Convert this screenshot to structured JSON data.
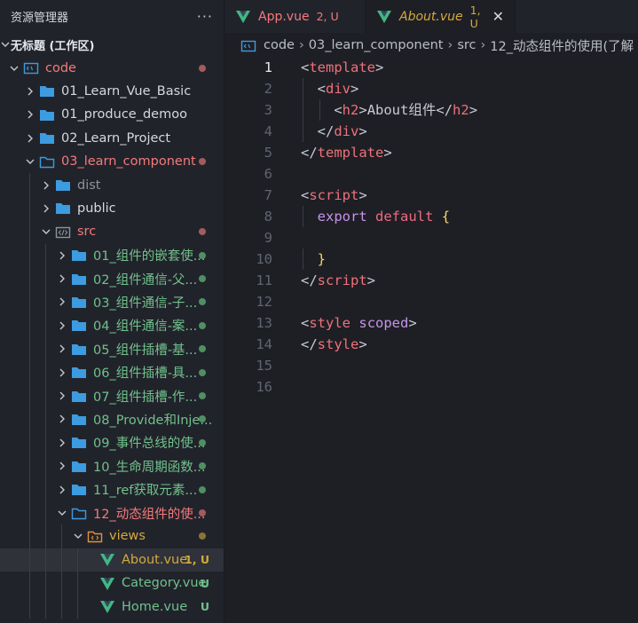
{
  "explorer": {
    "title": "资源管理器",
    "more": "···",
    "workspace": "无标题 (工作区)",
    "items": [
      {
        "label": "code",
        "type": "code-root",
        "level": 1,
        "expanded": true,
        "color": "#f47a7a",
        "status": "dot",
        "status_color": "#a35b5f"
      },
      {
        "label": "01_Learn_Vue_Basic",
        "type": "folder",
        "level": 2,
        "expanded": false,
        "color": "#d5d8de"
      },
      {
        "label": "01_produce_demoo",
        "type": "folder",
        "level": 2,
        "expanded": false,
        "color": "#d5d8de"
      },
      {
        "label": "02_Learn_Project",
        "type": "folder",
        "level": 2,
        "expanded": false,
        "color": "#d5d8de"
      },
      {
        "label": "03_learn_component",
        "type": "folder-open",
        "level": 2,
        "expanded": true,
        "color": "#f47a7a",
        "status": "dot",
        "status_color": "#a35b5f"
      },
      {
        "label": "dist",
        "type": "folder-gray",
        "level": 3,
        "expanded": false,
        "color": "#8e939b"
      },
      {
        "label": "public",
        "type": "folder",
        "level": 3,
        "expanded": false,
        "color": "#d5d8de"
      },
      {
        "label": "src",
        "type": "src",
        "level": 3,
        "expanded": true,
        "color": "#f47a7a",
        "status": "dot",
        "status_color": "#a35b5f"
      },
      {
        "label": "01_组件的嵌套使...",
        "type": "folder",
        "level": 4,
        "expanded": false,
        "color": "#71c18c",
        "status": "dot",
        "status_color": "#4f8f64"
      },
      {
        "label": "02_组件通信-父...",
        "type": "folder",
        "level": 4,
        "expanded": false,
        "color": "#71c18c",
        "status": "dot",
        "status_color": "#4f8f64"
      },
      {
        "label": "03_组件通信-子...",
        "type": "folder",
        "level": 4,
        "expanded": false,
        "color": "#71c18c",
        "status": "dot",
        "status_color": "#4f8f64"
      },
      {
        "label": "04_组件通信-案...",
        "type": "folder",
        "level": 4,
        "expanded": false,
        "color": "#71c18c",
        "status": "dot",
        "status_color": "#4f8f64"
      },
      {
        "label": "05_组件插槽-基...",
        "type": "folder",
        "level": 4,
        "expanded": false,
        "color": "#71c18c",
        "status": "dot",
        "status_color": "#4f8f64"
      },
      {
        "label": "06_组件插槽-具...",
        "type": "folder",
        "level": 4,
        "expanded": false,
        "color": "#71c18c",
        "status": "dot",
        "status_color": "#4f8f64"
      },
      {
        "label": "07_组件插槽-作...",
        "type": "folder",
        "level": 4,
        "expanded": false,
        "color": "#71c18c",
        "status": "dot",
        "status_color": "#4f8f64"
      },
      {
        "label": "08_Provide和Inje...",
        "type": "folder",
        "level": 4,
        "expanded": false,
        "color": "#71c18c",
        "status": "dot",
        "status_color": "#4f8f64"
      },
      {
        "label": "09_事件总线的使...",
        "type": "folder",
        "level": 4,
        "expanded": false,
        "color": "#71c18c",
        "status": "dot",
        "status_color": "#4f8f64"
      },
      {
        "label": "10_生命周期函数...",
        "type": "folder",
        "level": 4,
        "expanded": false,
        "color": "#71c18c",
        "status": "dot",
        "status_color": "#4f8f64"
      },
      {
        "label": "11_ref获取元素...",
        "type": "folder",
        "level": 4,
        "expanded": false,
        "color": "#71c18c",
        "status": "dot",
        "status_color": "#4f8f64"
      },
      {
        "label": "12_动态组件的使...",
        "type": "folder-open",
        "level": 4,
        "expanded": true,
        "color": "#f47a7a",
        "status": "dot",
        "status_color": "#a35b5f"
      },
      {
        "label": "views",
        "type": "views",
        "level": 5,
        "expanded": true,
        "color": "#d4a93a",
        "status": "dot",
        "status_color": "#8a7430"
      },
      {
        "label": "About.vue",
        "type": "vue",
        "level": 6,
        "color": "#d4a93a",
        "status": "1, U",
        "status_color": "#d4a93a",
        "selected": true
      },
      {
        "label": "Category.vue",
        "type": "vue",
        "level": 6,
        "color": "#71c18c",
        "status": "U",
        "status_color": "#71c18c"
      },
      {
        "label": "Home.vue",
        "type": "vue",
        "level": 6,
        "color": "#71c18c",
        "status": "U",
        "status_color": "#71c18c"
      }
    ]
  },
  "tabs": [
    {
      "name": "App.vue",
      "status": "2, U",
      "color": "#f47a7a",
      "italic": false,
      "active": false,
      "closable": false
    },
    {
      "name": "About.vue",
      "status": "1, U",
      "color": "#d4a93a",
      "italic": true,
      "active": true,
      "closable": true,
      "close": "✕"
    }
  ],
  "breadcrumb": {
    "sep": "›",
    "items": [
      "code",
      "03_learn_component",
      "src",
      "12_动态组件的使用(了解"
    ]
  },
  "editor": {
    "active_line": 1,
    "lines": [
      {
        "n": "1",
        "indent": 0,
        "tokens": [
          {
            "t": "<",
            "c": "br"
          },
          {
            "t": "template",
            "c": "tag"
          },
          {
            "t": ">",
            "c": "br"
          }
        ]
      },
      {
        "n": "2",
        "indent": 1,
        "tokens": [
          {
            "t": "<",
            "c": "br"
          },
          {
            "t": "div",
            "c": "tag"
          },
          {
            "t": ">",
            "c": "br"
          }
        ]
      },
      {
        "n": "3",
        "indent": 2,
        "tokens": [
          {
            "t": "<",
            "c": "br"
          },
          {
            "t": "h2",
            "c": "tag"
          },
          {
            "t": ">",
            "c": "br"
          },
          {
            "t": "About组件",
            "c": "text"
          },
          {
            "t": "</",
            "c": "br"
          },
          {
            "t": "h2",
            "c": "tag"
          },
          {
            "t": ">",
            "c": "br"
          }
        ]
      },
      {
        "n": "4",
        "indent": 1,
        "tokens": [
          {
            "t": "</",
            "c": "br"
          },
          {
            "t": "div",
            "c": "tag"
          },
          {
            "t": ">",
            "c": "br"
          }
        ]
      },
      {
        "n": "5",
        "indent": 0,
        "tokens": [
          {
            "t": "</",
            "c": "br"
          },
          {
            "t": "template",
            "c": "tag"
          },
          {
            "t": ">",
            "c": "br"
          }
        ]
      },
      {
        "n": "6",
        "indent": 0,
        "tokens": []
      },
      {
        "n": "7",
        "indent": 0,
        "tokens": [
          {
            "t": "<",
            "c": "br"
          },
          {
            "t": "script",
            "c": "tag"
          },
          {
            "t": ">",
            "c": "br"
          }
        ]
      },
      {
        "n": "8",
        "indent": 1,
        "tokens": [
          {
            "t": "export",
            "c": "kw"
          },
          {
            "t": " ",
            "c": "text"
          },
          {
            "t": "default",
            "c": "kw2"
          },
          {
            "t": " ",
            "c": "text"
          },
          {
            "t": "{",
            "c": "brace"
          }
        ]
      },
      {
        "n": "9",
        "indent": 0,
        "tokens": []
      },
      {
        "n": "10",
        "indent": 1,
        "tokens": [
          {
            "t": "}",
            "c": "brace"
          }
        ]
      },
      {
        "n": "11",
        "indent": 0,
        "tokens": [
          {
            "t": "</",
            "c": "br"
          },
          {
            "t": "script",
            "c": "tag"
          },
          {
            "t": ">",
            "c": "br"
          }
        ]
      },
      {
        "n": "12",
        "indent": 0,
        "tokens": []
      },
      {
        "n": "13",
        "indent": 0,
        "tokens": [
          {
            "t": "<",
            "c": "br"
          },
          {
            "t": "style",
            "c": "tag"
          },
          {
            "t": " ",
            "c": "text"
          },
          {
            "t": "scoped",
            "c": "attr"
          },
          {
            "t": ">",
            "c": "br"
          }
        ]
      },
      {
        "n": "14",
        "indent": 0,
        "tokens": [
          {
            "t": "</",
            "c": "br"
          },
          {
            "t": "style",
            "c": "tag"
          },
          {
            "t": ">",
            "c": "br"
          }
        ]
      },
      {
        "n": "15",
        "indent": 0,
        "tokens": []
      },
      {
        "n": "16",
        "indent": 0,
        "tokens": []
      }
    ]
  }
}
